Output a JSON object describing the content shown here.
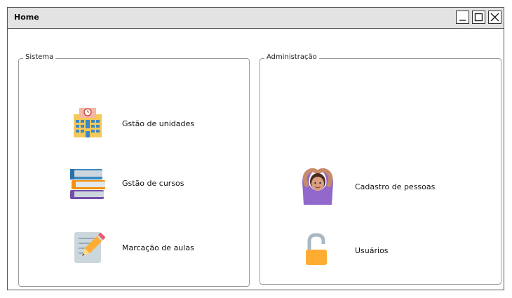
{
  "window": {
    "title": "Home"
  },
  "window_controls": [
    "minimize",
    "maximize",
    "close"
  ],
  "groups": {
    "sistema": {
      "title": "Sistema",
      "items": [
        {
          "label": "Gstão de unidades",
          "icon": "building-icon"
        },
        {
          "label": "Gstão de cursos",
          "icon": "books-icon"
        },
        {
          "label": "Marcação de aulas",
          "icon": "notepad-pencil-icon"
        }
      ]
    },
    "administracao": {
      "title": "Administração",
      "items": [
        {
          "label": "Cadastro de pessoas",
          "icon": "person-gesture-icon"
        },
        {
          "label": "Usuários",
          "icon": "unlocked-padlock-icon"
        }
      ]
    }
  }
}
